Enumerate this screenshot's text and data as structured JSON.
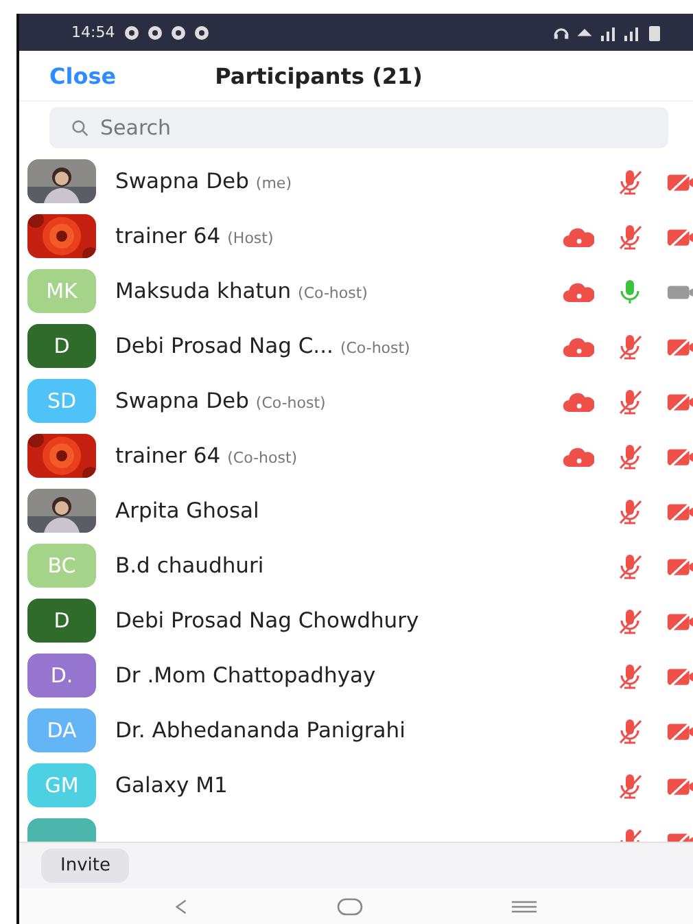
{
  "status_bar": {
    "time": "14:54"
  },
  "header": {
    "close": "Close",
    "title": "Participants (21)"
  },
  "search": {
    "placeholder": "Search"
  },
  "participants": [
    {
      "name": "Swapna Deb",
      "role": "(me)",
      "recording": false,
      "mic_muted": true,
      "video_muted": true
    },
    {
      "name": "trainer 64",
      "role": "(Host)",
      "recording": true,
      "mic_muted": true,
      "video_muted": true
    },
    {
      "avatar": {
        "kind": "initials",
        "initials": "MK",
        "color": "#a5d38a"
      },
      "name": "Maksuda khatun",
      "role": "(Co-host)",
      "recording": true,
      "mic_muted": false,
      "video_muted": false
    },
    {
      "avatar": {
        "kind": "initials",
        "initials": "D",
        "color": "#2f6b2a"
      },
      "name": "Debi Prosad Nag C...",
      "role": "(Co-host)",
      "recording": true,
      "mic_muted": true,
      "video_muted": true
    },
    {
      "avatar": {
        "kind": "initials",
        "initials": "SD",
        "color": "#4fc3f7"
      },
      "name": "Swapna Deb",
      "role": "(Co-host)",
      "recording": true,
      "mic_muted": true,
      "video_muted": true
    },
    {
      "name": "trainer 64",
      "role": "(Co-host)",
      "recording": true,
      "mic_muted": true,
      "video_muted": true
    },
    {
      "name": "Arpita Ghosal",
      "recording": false,
      "mic_muted": true,
      "video_muted": true
    },
    {
      "avatar": {
        "kind": "initials",
        "initials": "BC",
        "color": "#a5d38a"
      },
      "name": "B.d chaudhuri",
      "recording": false,
      "mic_muted": true,
      "video_muted": true
    },
    {
      "avatar": {
        "kind": "initials",
        "initials": "D",
        "color": "#2f6b2a"
      },
      "name": "Debi Prosad Nag Chowdhury",
      "recording": false,
      "mic_muted": true,
      "video_muted": true
    },
    {
      "avatar": {
        "kind": "initials",
        "initials": "D.",
        "color": "#9575cd"
      },
      "name": "Dr .Mom Chattopadhyay",
      "recording": false,
      "mic_muted": true,
      "video_muted": true
    },
    {
      "avatar": {
        "kind": "initials",
        "initials": "DA",
        "color": "#64b5f6"
      },
      "name": "Dr. Abhedananda Panigrahi",
      "recording": false,
      "mic_muted": true,
      "video_muted": true
    },
    {
      "avatar": {
        "kind": "initials",
        "initials": "GM",
        "color": "#4dd0e1"
      },
      "name": "Galaxy M1",
      "recording": false,
      "mic_muted": true,
      "video_muted": true
    },
    {
      "avatar": {
        "kind": "initials",
        "color": "#4db6ac"
      },
      "mic_muted": true,
      "video_muted": true
    }
  ],
  "footer": {
    "invite": "Invite"
  }
}
